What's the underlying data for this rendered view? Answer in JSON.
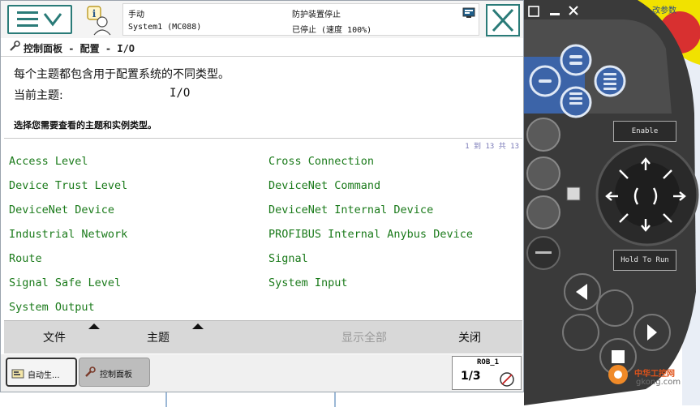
{
  "status": {
    "mode": "手动",
    "system": "System1 (MC088)",
    "safety": "防护装置停止",
    "state": "已停止 (速度 100%)"
  },
  "breadcrumb": "控制面板 - 配置 - I/O",
  "description": "每个主题都包含用于配置系统的不同类型。",
  "current_theme": {
    "label": "当前主题:",
    "value": "I/O"
  },
  "select_hint": "选择您需要查看的主题和实例类型。",
  "count": "1 到 13 共 13",
  "topics": [
    "Access Level",
    "Cross Connection",
    "Device Trust Level",
    "DeviceNet Command",
    "DeviceNet Device",
    "DeviceNet Internal Device",
    "Industrial Network",
    "PROFIBUS Internal Anybus Device",
    "Route",
    "Signal",
    "Signal Safe Level",
    "System Input",
    "System Output"
  ],
  "commands": {
    "file": "文件",
    "theme": "主题",
    "show_all": "显示全部",
    "close": "关闭"
  },
  "taskbar": {
    "auto": "自动生...",
    "control_panel": "控制面板",
    "robot": "ROB_1",
    "fraction": "1/3"
  },
  "device": {
    "enable": "Enable",
    "hold": "Hold To Run",
    "param": "改参数"
  },
  "watermark": {
    "title": "中华工控网",
    "url": "gkong.com"
  },
  "colors": {
    "accent": "#2a7b78",
    "topic_text": "#1a7a1a",
    "device_blue": "#3c64a8",
    "device_body": "#3a3a3a",
    "estop_yellow": "#f1e200",
    "estop_red": "#d83030"
  }
}
